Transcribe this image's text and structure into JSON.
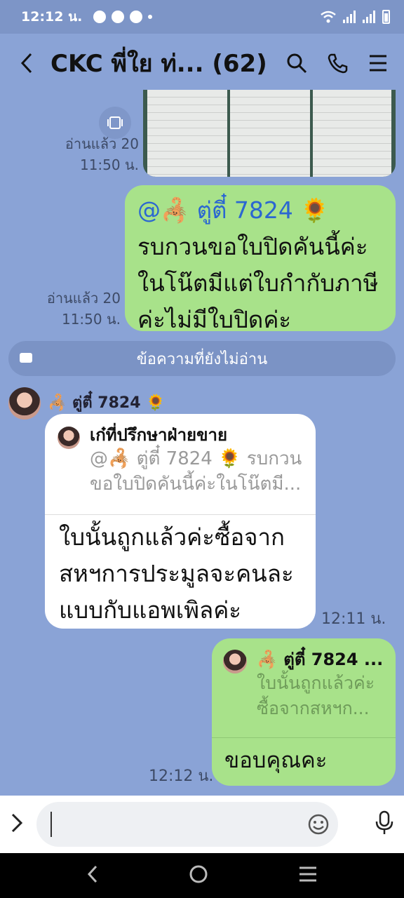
{
  "status_bar": {
    "time": "12:12 น."
  },
  "header": {
    "title": "CKC พี่ใย ท่...",
    "member_count": "(62)"
  },
  "messages": {
    "read_1": {
      "label": "อ่านแล้ว 20",
      "time": "11:50 น."
    },
    "outgoing_1": {
      "mention": "@🦂 ตู่ตี๋ 7824 🌻",
      "lines": [
        "รบกวนขอใบปิดคันนี้ค่ะ",
        "ในโน๊ตมีแต่ใบกำกับภาษี",
        "ค่ะไม่มีใบปิดค่ะ"
      ]
    },
    "read_2": {
      "label": "อ่านแล้ว 20",
      "time": "11:50 น."
    },
    "unread_divider": "ข้อความที่ยังไม่อ่าน",
    "incoming_1": {
      "sender": "🦂 ตู่ตี๋ 7824 🌻",
      "reply_author": "เก๋ที่ปรึกษาฝ่ายขาย",
      "reply_quote_1": "@🦂 ตู่ตี๋ 7824 🌻 รบกวน",
      "reply_quote_2": "ขอใบปิดคันนี้ค่ะในโน๊ตมี...",
      "lines": [
        "ใบนั้นถูกแล้วค่ะซื้อจาก",
        "สหฯการประมูลจะคนละ",
        "แบบกับแอพเพิลค่ะ"
      ],
      "time": "12:11 น."
    },
    "outgoing_2": {
      "reply_author": "🦂 ตู่ตี๋ 7824 ...",
      "reply_quote_1": "ใบนั้นถูกแล้วค่ะ",
      "reply_quote_2": "ซื้อจากสหฯก...",
      "text": "ขอบคุณคะ",
      "time": "12:12 น."
    }
  },
  "icons": {
    "back": "chevron-left-icon",
    "search": "search-icon",
    "call": "phone-icon",
    "menu": "menu-icon",
    "expand": "chevron-right-icon",
    "emoji": "smiley-icon",
    "mic": "microphone-icon"
  },
  "colors": {
    "chat_bg": "#8aa3d6",
    "outgoing_bubble": "#a8e28a",
    "incoming_bubble": "#ffffff",
    "mention": "#2b67d1"
  }
}
